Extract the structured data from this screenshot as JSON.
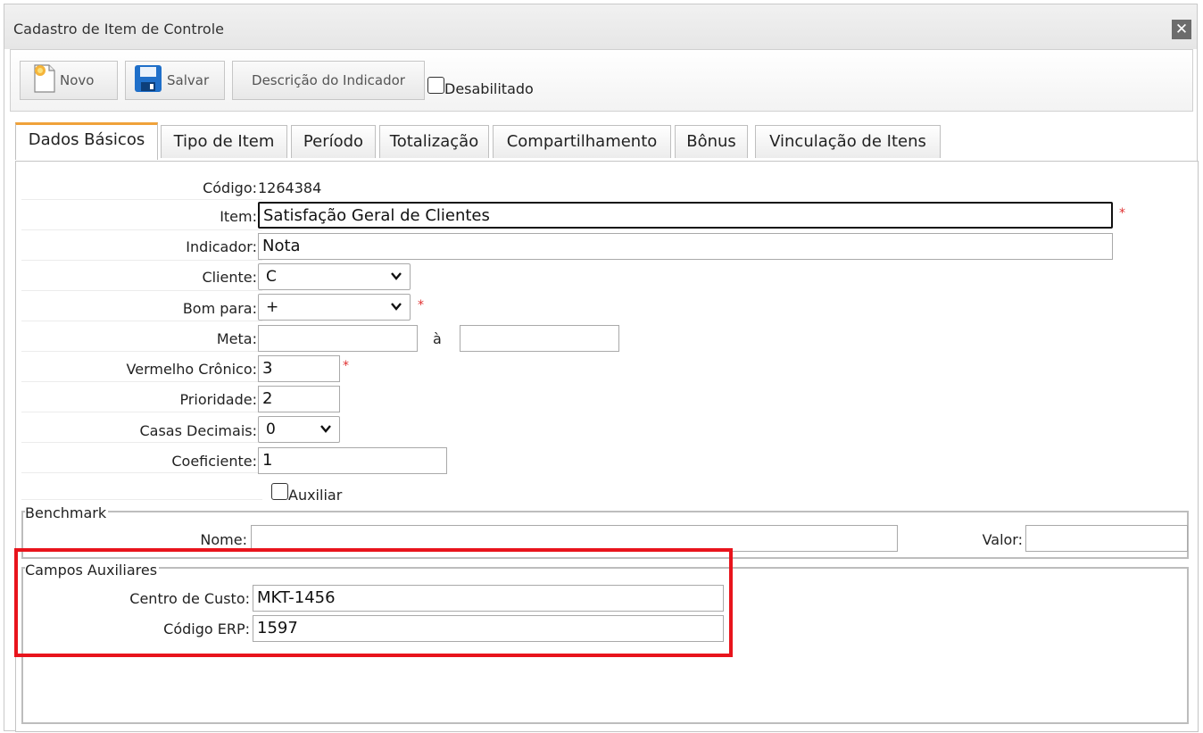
{
  "window": {
    "title": "Cadastro de Item de Controle",
    "close_label": "✕"
  },
  "toolbar": {
    "new_label": "Novo",
    "save_label": "Salvar",
    "indicator_desc_label": "Descrição do Indicador",
    "disabled_label": "Desabilitado"
  },
  "tabs": [
    {
      "label": "Dados Básicos"
    },
    {
      "label": "Tipo de Item"
    },
    {
      "label": "Período"
    },
    {
      "label": "Totalização"
    },
    {
      "label": "Compartilhamento"
    },
    {
      "label": "Bônus"
    },
    {
      "label": "Vinculação de Itens"
    }
  ],
  "form": {
    "codigo_label": "Código:",
    "codigo_value": "1264384",
    "item_label": "Item:",
    "item_value": "Satisfação Geral de Clientes",
    "indicador_label": "Indicador:",
    "indicador_value": "Nota",
    "cliente_label": "Cliente:",
    "cliente_value": "C",
    "bom_para_label": "Bom para:",
    "bom_para_value": "+",
    "meta_label": "Meta:",
    "meta_from": "",
    "meta_sep": "à",
    "meta_to": "",
    "vermelho_label": "Vermelho Crônico:",
    "vermelho_value": "3",
    "prioridade_label": "Prioridade:",
    "prioridade_value": "2",
    "casas_label": "Casas Decimais:",
    "casas_value": "0",
    "coeficiente_label": "Coeficiente:",
    "coeficiente_value": "1",
    "auxiliar_label": "Auxiliar",
    "required_mark": "*"
  },
  "benchmark": {
    "legend": "Benchmark",
    "nome_label": "Nome:",
    "nome_value": "",
    "valor_label": "Valor:",
    "valor_value": ""
  },
  "auxiliares": {
    "legend": "Campos Auxiliares",
    "centro_label": "Centro de Custo:",
    "centro_value": "MKT-1456",
    "erp_label": "Código ERP:",
    "erp_value": "1597"
  },
  "colors": {
    "highlight": "#e8141c",
    "required": "#e03030",
    "active_tab": "#f0a23a"
  }
}
